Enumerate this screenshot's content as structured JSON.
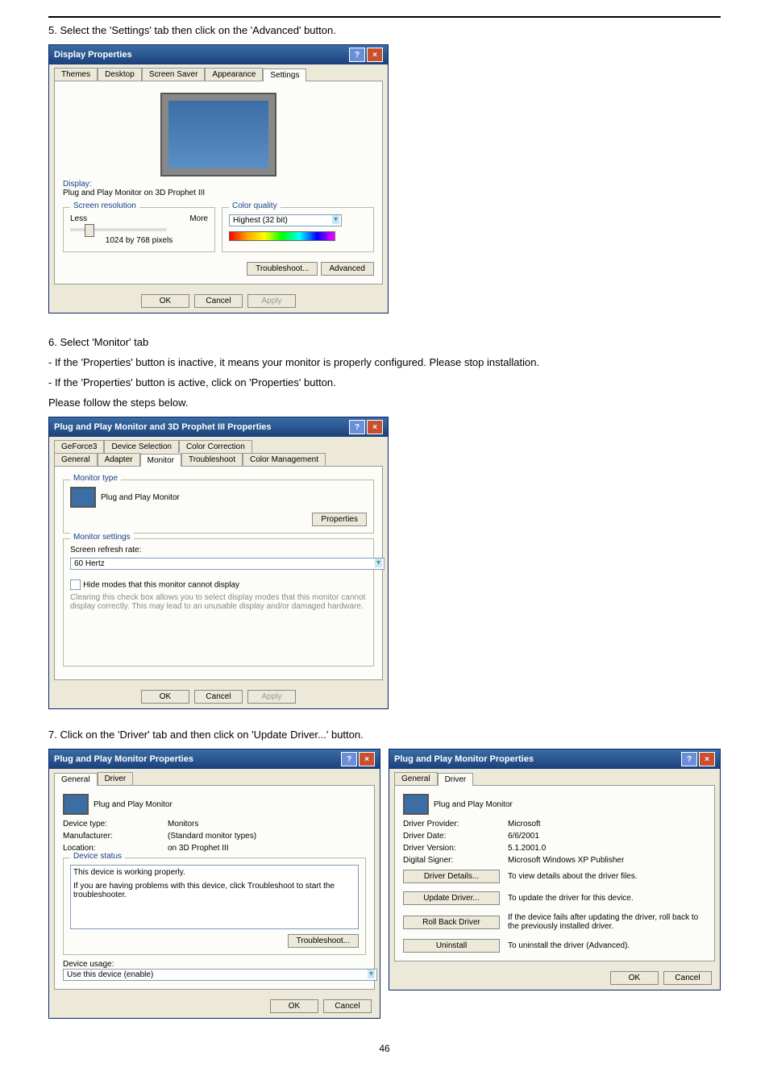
{
  "step5": "5. Select the 'Settings' tab then click on the 'Advanced' button.",
  "d1": {
    "title": "Display Properties",
    "tabs": [
      "Themes",
      "Desktop",
      "Screen Saver",
      "Appearance",
      "Settings"
    ],
    "display_label": "Display:",
    "display_val": "Plug and Play Monitor on 3D Prophet III",
    "res_group": "Screen resolution",
    "less": "Less",
    "more": "More",
    "res_val": "1024 by 768 pixels",
    "cq_group": "Color quality",
    "cq_val": "Highest (32 bit)",
    "troubleshoot": "Troubleshoot...",
    "advanced": "Advanced",
    "ok": "OK",
    "cancel": "Cancel",
    "apply": "Apply"
  },
  "step6": "6. Select 'Monitor' tab",
  "note1": "- If the 'Properties' button is inactive, it means your monitor is properly configured. Please stop installation.",
  "note2": "- If the 'Properties' button is active, click on 'Properties' button.",
  "note3": "Please follow the steps below.",
  "d2": {
    "title": "Plug and Play Monitor and 3D Prophet III Properties",
    "tabs_top": [
      "GeForce3",
      "Device Selection",
      "Color Correction"
    ],
    "tabs_bot": [
      "General",
      "Adapter",
      "Monitor",
      "Troubleshoot",
      "Color Management"
    ],
    "mt": "Monitor type",
    "mt_val": "Plug and Play Monitor",
    "props": "Properties",
    "ms": "Monitor settings",
    "srr": "Screen refresh rate:",
    "srr_val": "60 Hertz",
    "hide": "Hide modes that this monitor cannot display",
    "hide_desc": "Clearing this check box allows you to select display modes that this monitor cannot display correctly. This may lead to an unusable display and/or damaged hardware.",
    "ok": "OK",
    "cancel": "Cancel",
    "apply": "Apply"
  },
  "step7": "7. Click on the 'Driver' tab and then click on 'Update Driver...' button.",
  "d3": {
    "title": "Plug and Play Monitor Properties",
    "tabs": [
      "General",
      "Driver"
    ],
    "name": "Plug and Play Monitor",
    "k_type": "Device type:",
    "v_type": "Monitors",
    "k_mfr": "Manufacturer:",
    "v_mfr": "(Standard monitor types)",
    "k_loc": "Location:",
    "v_loc": "on 3D Prophet III",
    "ds": "Device status",
    "ds_txt": "This device is working properly.",
    "ds_hint": "If you are having problems with this device, click Troubleshoot to start the troubleshooter.",
    "ts": "Troubleshoot...",
    "du": "Device usage:",
    "du_val": "Use this device (enable)",
    "ok": "OK",
    "cancel": "Cancel"
  },
  "d4": {
    "title": "Plug and Play Monitor Properties",
    "tabs": [
      "General",
      "Driver"
    ],
    "name": "Plug and Play Monitor",
    "k_prov": "Driver Provider:",
    "v_prov": "Microsoft",
    "k_date": "Driver Date:",
    "v_date": "6/6/2001",
    "k_ver": "Driver Version:",
    "v_ver": "5.1.2001.0",
    "k_sig": "Digital Signer:",
    "v_sig": "Microsoft Windows XP Publisher",
    "b_det": "Driver Details...",
    "t_det": "To view details about the driver files.",
    "b_upd": "Update Driver...",
    "t_upd": "To update the driver for this device.",
    "b_roll": "Roll Back Driver",
    "t_roll": "If the device fails after updating the driver, roll back to the previously installed driver.",
    "b_un": "Uninstall",
    "t_un": "To uninstall the driver (Advanced).",
    "ok": "OK",
    "cancel": "Cancel"
  },
  "pagenum": "46"
}
